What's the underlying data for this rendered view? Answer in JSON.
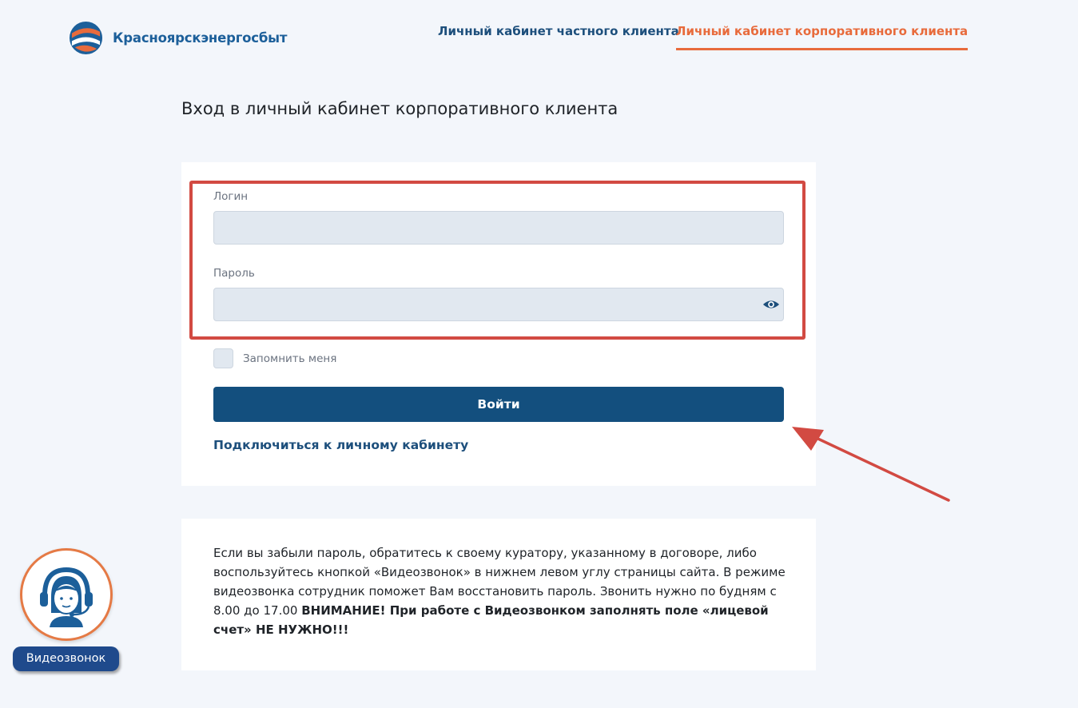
{
  "header": {
    "brand_name": "Красноярскэнергосбыт",
    "nav": {
      "private_tab": "Личный кабинет частного клиента",
      "corporate_tab": "Личный кабинет корпоративного клиента"
    },
    "active_tab": "corporate"
  },
  "page": {
    "title": "Вход в личный кабинет корпоративного клиента"
  },
  "login_form": {
    "login_label": "Логин",
    "login_value": "",
    "password_label": "Пароль",
    "password_value": "",
    "remember_label": "Запомнить меня",
    "remember_checked": false,
    "submit_label": "Войти",
    "connect_link": "Подключиться к личному кабинету"
  },
  "info": {
    "text": "Если вы забыли пароль, обратитесь к своему куратору, указанному в договоре, либо воспользуйтесь кнопкой «Видеозвонок» в нижнем левом углу страницы сайта. В режиме видеозвонка сотрудник поможет Вам восстановить пароль. Звонить нужно по будням с 8.00 до 17.00",
    "warning": "ВНИМАНИЕ! При работе с Видеозвонком заполнять поле «лицевой счет» НЕ НУЖНО!!!"
  },
  "video_call": {
    "label": "Видеозвонок",
    "icon": "operator-headset-icon"
  },
  "colors": {
    "accent_orange": "#e86b3c",
    "primary_blue": "#134f7e",
    "highlight_red": "#d24a42"
  }
}
